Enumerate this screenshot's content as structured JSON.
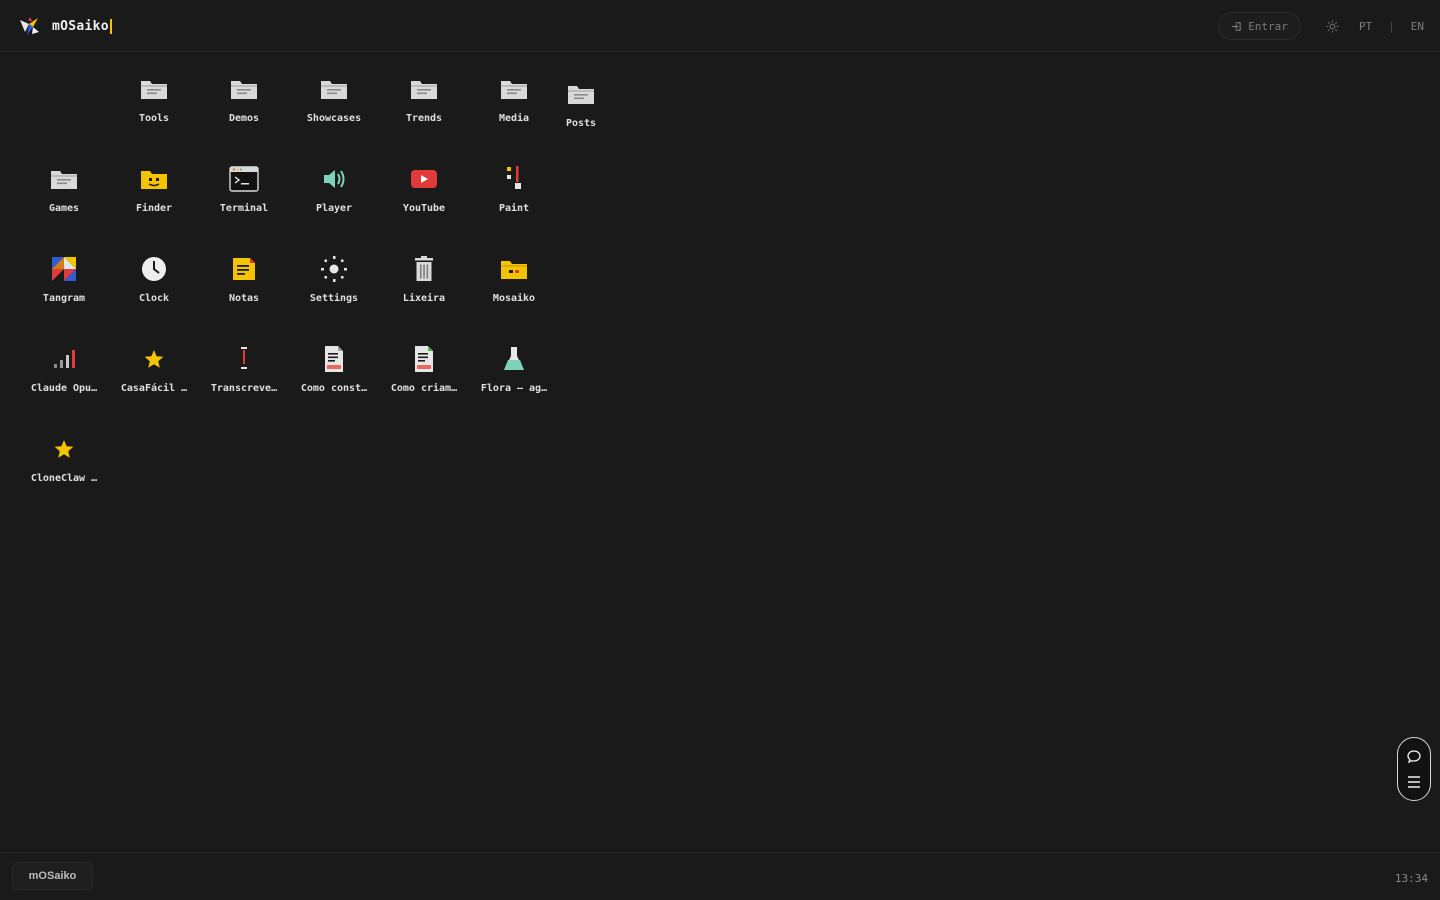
{
  "topbar": {
    "brand_title": "mOSaiko",
    "login_label": "Entrar",
    "lang_pt": "PT",
    "lang_sep": "|",
    "lang_en": "EN"
  },
  "desktop": {
    "icons": [
      {
        "label": "Tools",
        "icon": "folder-icon"
      },
      {
        "label": "Demos",
        "icon": "folder-icon"
      },
      {
        "label": "Showcases",
        "icon": "folder-icon"
      },
      {
        "label": "Trends",
        "icon": "folder-icon"
      },
      {
        "label": "Media",
        "icon": "folder-icon"
      },
      {
        "label": "Posts",
        "icon": "folder-icon"
      },
      {
        "label": "Games",
        "icon": "folder-icon"
      },
      {
        "label": "Finder",
        "icon": "finder-icon"
      },
      {
        "label": "Terminal",
        "icon": "terminal-icon"
      },
      {
        "label": "Player",
        "icon": "speaker-icon"
      },
      {
        "label": "YouTube",
        "icon": "youtube-icon"
      },
      {
        "label": "Paint",
        "icon": "paint-icon"
      },
      {
        "label": "Tangram",
        "icon": "tangram-icon"
      },
      {
        "label": "Clock",
        "icon": "clock-icon"
      },
      {
        "label": "Notas",
        "icon": "notes-icon"
      },
      {
        "label": "Settings",
        "icon": "gear-icon"
      },
      {
        "label": "Lixeira",
        "icon": "trash-icon"
      },
      {
        "label": "Mosaiko",
        "icon": "mosaiko-folder-icon"
      },
      {
        "label": "Claude Opu…",
        "icon": "bar-chart-icon"
      },
      {
        "label": "CasaFácil …",
        "icon": "star-icon"
      },
      {
        "label": "Transcreve…",
        "icon": "exclamation-icon"
      },
      {
        "label": "Como const…",
        "icon": "document-icon"
      },
      {
        "label": "Como criam…",
        "icon": "document-icon"
      },
      {
        "label": "Flora — ag…",
        "icon": "flask-icon"
      },
      {
        "label": "CloneClaw …",
        "icon": "star-icon"
      }
    ]
  },
  "colors": {
    "background": "#1a1a1a",
    "accent_yellow": "#f5c400",
    "youtube_red": "#e23a3a",
    "player_teal": "#7fd1b9"
  },
  "taskbar": {
    "start_label": "mOSaiko",
    "clock": "13:34"
  }
}
